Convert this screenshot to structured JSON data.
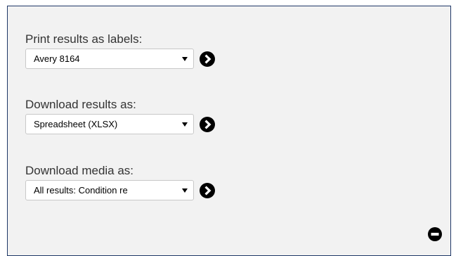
{
  "print_labels": {
    "label": "Print results as labels:",
    "selected": "Avery 8164"
  },
  "download_results": {
    "label": "Download results as:",
    "selected": "Spreadsheet (XLSX)"
  },
  "download_media": {
    "label": "Download media as:",
    "selected": "All results: Condition re"
  },
  "icons": {
    "go": "chevron-right-circle-icon",
    "collapse": "minus-circle-icon"
  },
  "colors": {
    "panel_background": "#f2f2f2",
    "panel_border": "#1e3766",
    "icon": "#000000"
  }
}
